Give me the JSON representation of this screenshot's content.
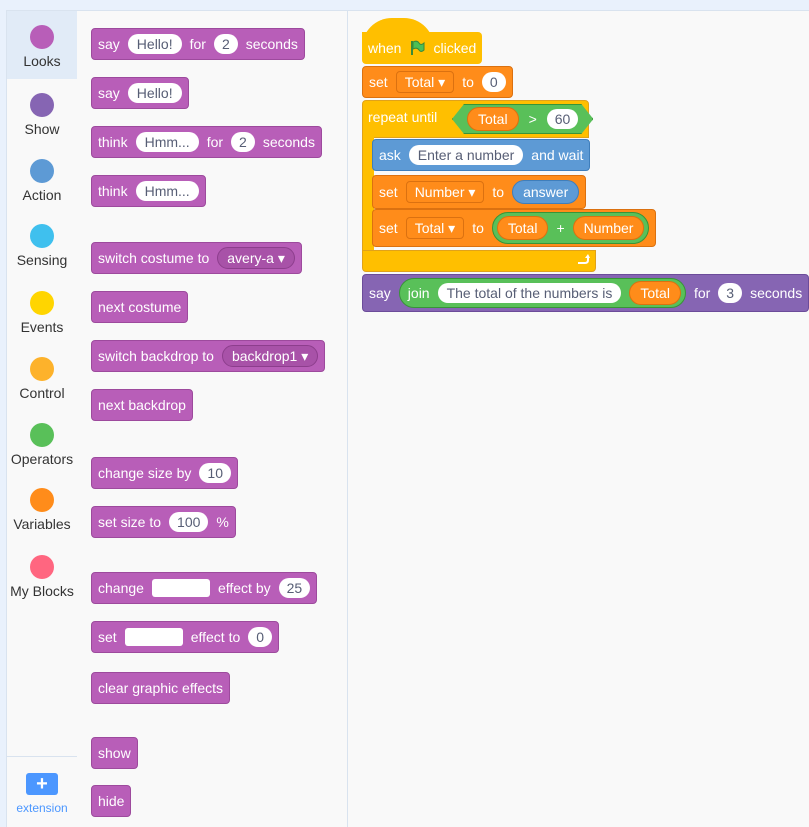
{
  "categories": [
    {
      "label": "Looks",
      "color": "#b85eb8"
    },
    {
      "label": "Show",
      "color": "#8665b3"
    },
    {
      "label": "Action",
      "color": "#5d9ad5"
    },
    {
      "label": "Sensing",
      "color": "#3fc0ee"
    },
    {
      "label": "Events",
      "color": "#ffd500"
    },
    {
      "label": "Control",
      "color": "#fdb22b"
    },
    {
      "label": "Operators",
      "color": "#59c059"
    },
    {
      "label": "Variables",
      "color": "#ff8c1a"
    },
    {
      "label": "My Blocks",
      "color": "#ff6680"
    }
  ],
  "extension_label": "extension",
  "palette": {
    "say_for": {
      "say": "say",
      "text": "Hello!",
      "for": "for",
      "secs": "2",
      "seconds": "seconds"
    },
    "say": {
      "say": "say",
      "text": "Hello!"
    },
    "think_for": {
      "think": "think",
      "text": "Hmm...",
      "for": "for",
      "secs": "2",
      "seconds": "seconds"
    },
    "think": {
      "think": "think",
      "text": "Hmm..."
    },
    "switch_costume": {
      "label": "switch costume to",
      "value": "avery-a ▾"
    },
    "next_costume": "next costume",
    "switch_backdrop": {
      "label": "switch backdrop to",
      "value": "backdrop1 ▾"
    },
    "next_backdrop": "next backdrop",
    "change_size": {
      "label": "change size by",
      "value": "10"
    },
    "set_size": {
      "label": "set size to",
      "value": "100",
      "unit": "%"
    },
    "change_effect": {
      "change": "change",
      "effect_by": "effect by",
      "value": "25"
    },
    "set_effect": {
      "set": "set",
      "effect_to": "effect to",
      "value": "0"
    },
    "clear_effects": "clear graphic effects",
    "show": "show",
    "hide": "hide"
  },
  "script": {
    "when": "when",
    "clicked": "clicked",
    "set1": {
      "set": "set",
      "var": "Total ▾",
      "to": "to",
      "value": "0"
    },
    "repeat": {
      "label": "repeat until",
      "var": "Total",
      "op": ">",
      "value": "60"
    },
    "ask": {
      "ask": "ask",
      "prompt": "Enter a number",
      "and_wait": "and wait"
    },
    "set2": {
      "set": "set",
      "var": "Number ▾",
      "to": "to",
      "value": "answer"
    },
    "set3": {
      "set": "set",
      "var": "Total ▾",
      "to": "to",
      "a": "Total",
      "plus": "+",
      "b": "Number"
    },
    "say": {
      "say": "say",
      "join": "join",
      "text": "The total of the numbers is",
      "var": "Total",
      "for": "for",
      "secs": "3",
      "seconds": "seconds"
    }
  }
}
